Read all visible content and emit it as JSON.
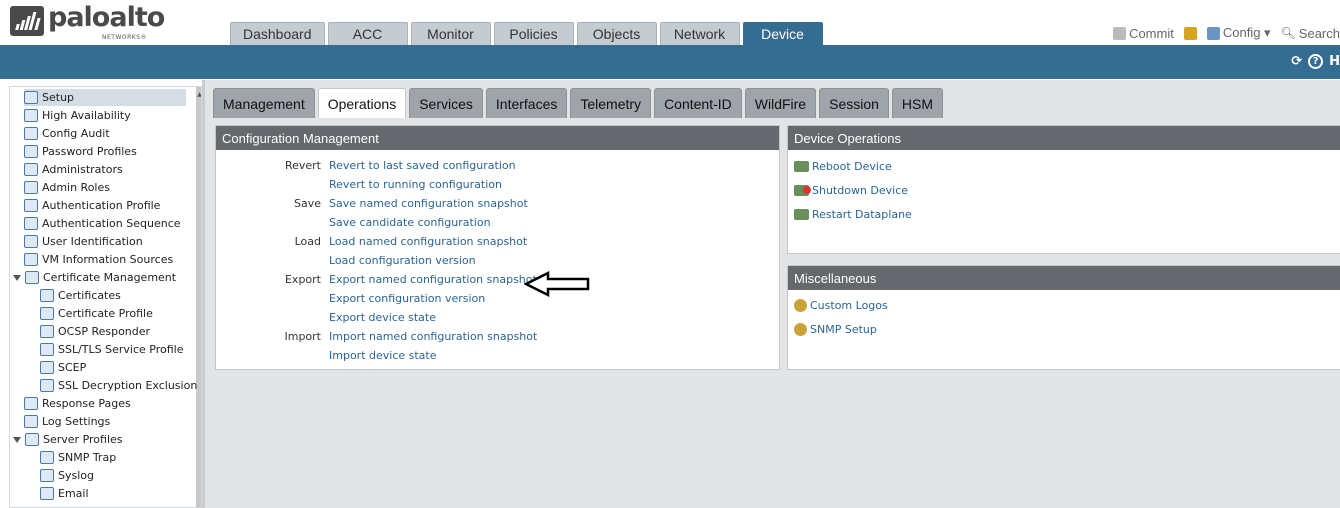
{
  "brand": {
    "name": "paloalto",
    "sub": "NETWORKS®"
  },
  "nav_tabs": [
    "Dashboard",
    "ACC",
    "Monitor",
    "Policies",
    "Objects",
    "Network",
    "Device"
  ],
  "active_nav": "Device",
  "toolbar": {
    "commit": "Commit",
    "config": "Config ▾",
    "search": "Search"
  },
  "bluebar": {
    "refresh": "⟳",
    "help": "?",
    "help_text": "H"
  },
  "sidebar_items": [
    {
      "label": "Setup",
      "level": 0,
      "selected": true
    },
    {
      "label": "High Availability",
      "level": 0
    },
    {
      "label": "Config Audit",
      "level": 0
    },
    {
      "label": "Password Profiles",
      "level": 0
    },
    {
      "label": "Administrators",
      "level": 0
    },
    {
      "label": "Admin Roles",
      "level": 0
    },
    {
      "label": "Authentication Profile",
      "level": 0
    },
    {
      "label": "Authentication Sequence",
      "level": 0
    },
    {
      "label": "User Identification",
      "level": 0
    },
    {
      "label": "VM Information Sources",
      "level": 0
    },
    {
      "label": "Certificate Management",
      "level": 0,
      "expanded": true
    },
    {
      "label": "Certificates",
      "level": 1
    },
    {
      "label": "Certificate Profile",
      "level": 1
    },
    {
      "label": "OCSP Responder",
      "level": 1
    },
    {
      "label": "SSL/TLS Service Profile",
      "level": 1
    },
    {
      "label": "SCEP",
      "level": 1
    },
    {
      "label": "SSL Decryption Exclusion",
      "level": 1
    },
    {
      "label": "Response Pages",
      "level": 0
    },
    {
      "label": "Log Settings",
      "level": 0
    },
    {
      "label": "Server Profiles",
      "level": 0,
      "expanded": true
    },
    {
      "label": "SNMP Trap",
      "level": 1
    },
    {
      "label": "Syslog",
      "level": 1
    },
    {
      "label": "Email",
      "level": 1
    }
  ],
  "sub_tabs": [
    "Management",
    "Operations",
    "Services",
    "Interfaces",
    "Telemetry",
    "Content-ID",
    "WildFire",
    "Session",
    "HSM"
  ],
  "active_sub_tab": "Operations",
  "config_management": {
    "title": "Configuration Management",
    "rows": [
      {
        "label": "Revert",
        "links": [
          "Revert to last saved configuration",
          "Revert to running configuration"
        ]
      },
      {
        "label": "Save",
        "links": [
          "Save named configuration snapshot",
          "Save candidate configuration"
        ]
      },
      {
        "label": "Load",
        "links": [
          "Load named configuration snapshot",
          "Load configuration version"
        ]
      },
      {
        "label": "Export",
        "links": [
          "Export named configuration snapshot",
          "Export configuration version",
          "Export device state"
        ]
      },
      {
        "label": "Import",
        "links": [
          "Import named configuration snapshot",
          "Import device state"
        ]
      }
    ]
  },
  "device_operations": {
    "title": "Device Operations",
    "items": [
      "Reboot Device",
      "Shutdown Device",
      "Restart Dataplane"
    ]
  },
  "miscellaneous": {
    "title": "Miscellaneous",
    "items": [
      "Custom Logos",
      "SNMP Setup"
    ]
  },
  "colors": {
    "header_blue": "#356d92",
    "link": "#2a6496",
    "panel_title": "#65696d"
  }
}
